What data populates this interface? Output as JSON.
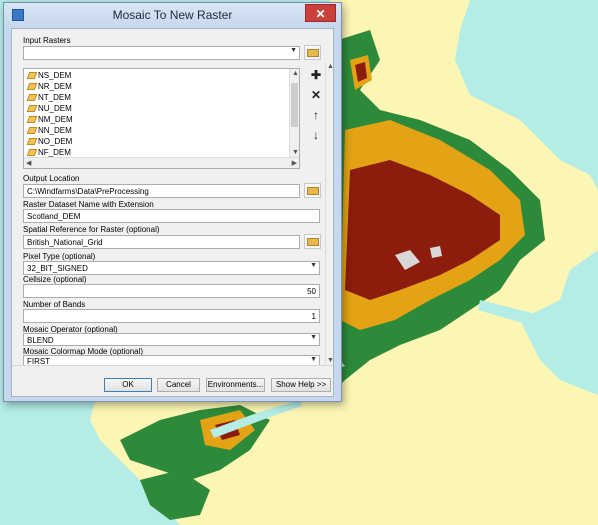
{
  "window": {
    "title": "Mosaic To New Raster",
    "close_glyph": "✕"
  },
  "input_rasters": {
    "label": "Input Rasters",
    "value": "",
    "items": [
      "NS_DEM",
      "NR_DEM",
      "NT_DEM",
      "NU_DEM",
      "NM_DEM",
      "NN_DEM",
      "NO_DEM",
      "NF_DEM"
    ],
    "item_icon": "raster-dataset-icon",
    "add_glyph": "✚",
    "remove_glyph": "✕",
    "up_glyph": "↑",
    "down_glyph": "↓"
  },
  "output_location": {
    "label": "Output Location",
    "value": "C:\\Windfarms\\Data\\PreProcessing"
  },
  "raster_name": {
    "label": "Raster Dataset Name with Extension",
    "value": "Scotland_DEM"
  },
  "spatial_reference": {
    "label": "Spatial Reference for Raster (optional)",
    "value": "British_National_Grid"
  },
  "pixel_type": {
    "label": "Pixel Type (optional)",
    "value": "32_BIT_SIGNED"
  },
  "cellsize": {
    "label": "Cellsize (optional)",
    "value": "50"
  },
  "number_of_bands": {
    "label": "Number of Bands",
    "value": "1"
  },
  "mosaic_operator": {
    "label": "Mosaic Operator (optional)",
    "value": "BLEND"
  },
  "colormap_mode": {
    "label": "Mosaic Colormap Mode (optional)",
    "value": "FIRST"
  },
  "buttons": {
    "ok": "OK",
    "cancel": "Cancel",
    "environments": "Environments...",
    "show_help": "Show Help >>"
  },
  "map_colors": {
    "sea": "#b4ece6",
    "lowland": "#fcf6b4",
    "green": "#2d8a3a",
    "orange": "#e3a314",
    "brown": "#8c1c0c",
    "peak": "#d8d8d8"
  }
}
